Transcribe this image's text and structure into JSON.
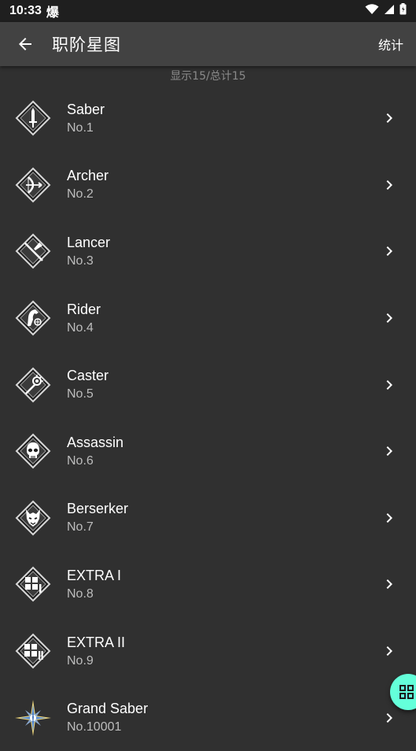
{
  "status_bar": {
    "time": "10:33",
    "notification_glyph": "爆"
  },
  "app_bar": {
    "title": "职阶星图",
    "action_label": "统计"
  },
  "summary": "显示15/总计15",
  "items": [
    {
      "name": "Saber",
      "no": "No.1",
      "icon": "saber-class-icon"
    },
    {
      "name": "Archer",
      "no": "No.2",
      "icon": "archer-class-icon"
    },
    {
      "name": "Lancer",
      "no": "No.3",
      "icon": "lancer-class-icon"
    },
    {
      "name": "Rider",
      "no": "No.4",
      "icon": "rider-class-icon"
    },
    {
      "name": "Caster",
      "no": "No.5",
      "icon": "caster-class-icon"
    },
    {
      "name": "Assassin",
      "no": "No.6",
      "icon": "assassin-class-icon"
    },
    {
      "name": "Berserker",
      "no": "No.7",
      "icon": "berserker-class-icon"
    },
    {
      "name": "EXTRA I",
      "no": "No.8",
      "icon": "extra-i-class-icon"
    },
    {
      "name": "EXTRA II",
      "no": "No.9",
      "icon": "extra-ii-class-icon"
    },
    {
      "name": "Grand Saber",
      "no": "No.10001",
      "icon": "grand-saber-class-icon"
    }
  ],
  "colors": {
    "background": "#303030",
    "app_bar": "#424242",
    "status_bar": "#1f1f1f",
    "fab": "#64ffda",
    "secondary_text": "#bdbdbd"
  }
}
